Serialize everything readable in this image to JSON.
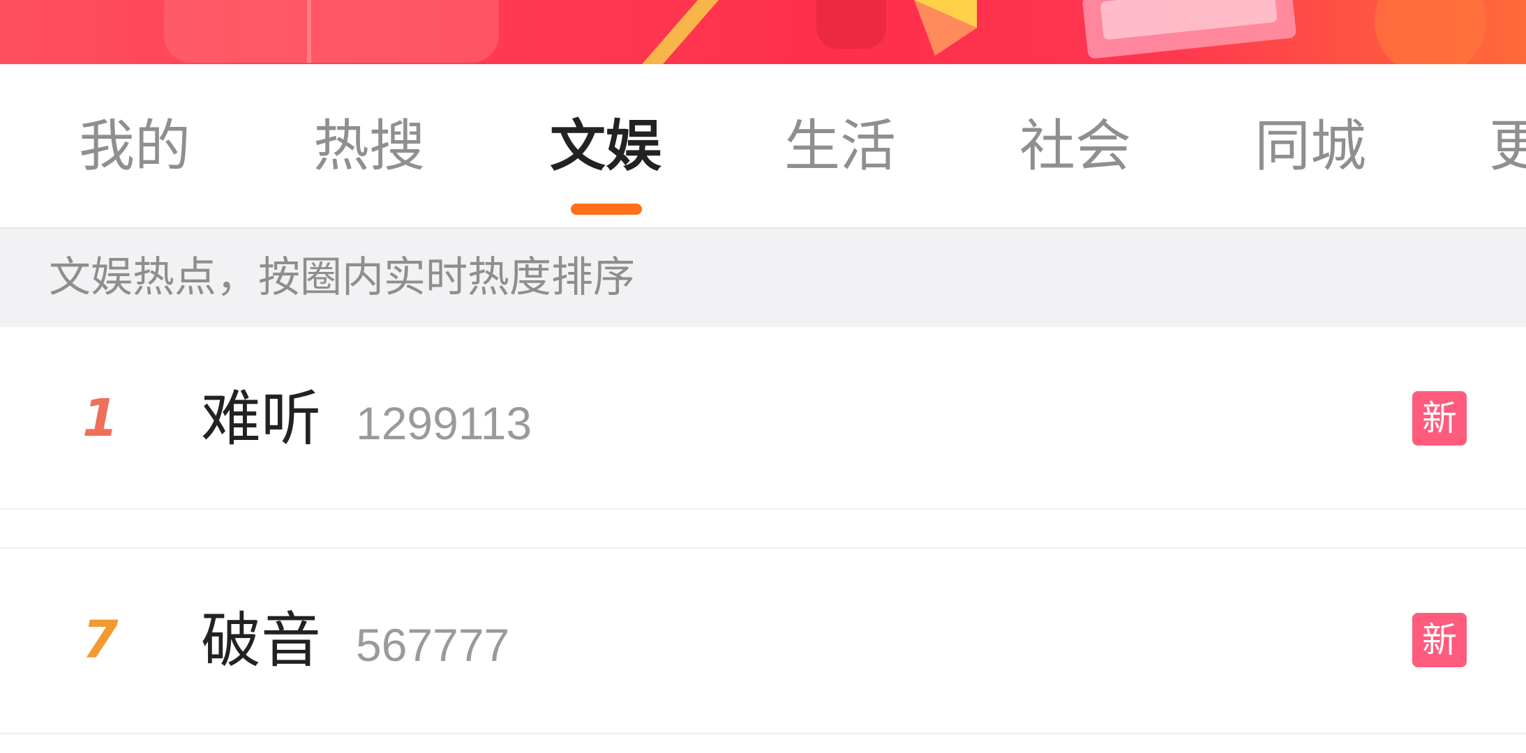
{
  "tabs": [
    {
      "label": "我的"
    },
    {
      "label": "热搜"
    },
    {
      "label": "文娱"
    },
    {
      "label": "生活"
    },
    {
      "label": "社会"
    },
    {
      "label": "同城"
    },
    {
      "label": "更"
    }
  ],
  "active_tab": "文娱",
  "hint": {
    "text": "文娱热点，按圈内实时热度排序"
  },
  "list": [
    {
      "rank": "1",
      "title": "难听",
      "count": "1299113",
      "badge": "新",
      "rank_color": "#ee6f5a"
    },
    {
      "rank": "7",
      "title": "破音",
      "count": "567777",
      "badge": "新",
      "rank_color": "#f29a32"
    }
  ],
  "colors": {
    "accent": "#ff6f1a",
    "badge": "#ff5b7c",
    "banner": "#ff3b53"
  }
}
